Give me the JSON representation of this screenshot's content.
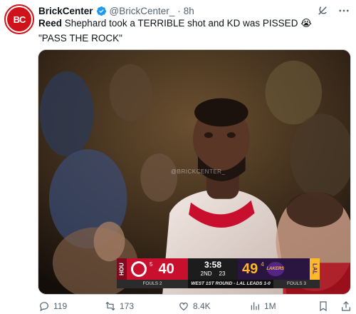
{
  "tweet": {
    "avatar_text": "BC",
    "author_name": "BrickCenter",
    "handle": "@BrickCenter_",
    "separator": "·",
    "timestamp": "8h",
    "text_bold": "Reed",
    "text_rest": " Shephard took a TERRIBLE shot and KD was PISSED 😭",
    "quote_line": "\"PASS THE ROCK\""
  },
  "media": {
    "watermark": "@BRICKCENTER_",
    "scorebug": {
      "home_tag": "HOU",
      "home_seed": "5",
      "home_score": "40",
      "clock": "3:58",
      "quarter": "2ND",
      "shot_clock": "23",
      "away_score": "49",
      "away_seed": "4",
      "away_logo_text": "LAKERS",
      "away_tag": "LAL",
      "home_fouls": "FOULS 2",
      "series": "WEST 1ST ROUND - LAL LEADS 1-0",
      "away_fouls": "FOULS 3"
    }
  },
  "actions": {
    "replies": "119",
    "reposts": "173",
    "likes": "8.4K",
    "views": "1M"
  },
  "colors": {
    "rockets_red": "#c8102e",
    "lakers_gold": "#fdb927",
    "lakers_purple": "#552583",
    "verified_blue": "#1d9bf0",
    "muted_text": "#536471"
  }
}
